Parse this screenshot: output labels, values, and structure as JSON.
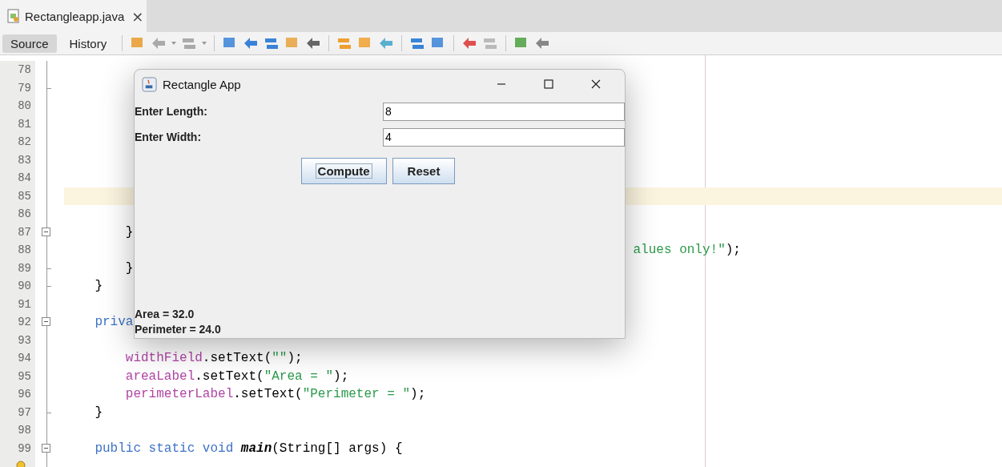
{
  "editor_tab": {
    "title": "Rectangleapp.java",
    "close": "×"
  },
  "view_tabs": [
    {
      "label": "Source",
      "selected": true
    },
    {
      "label": "History",
      "selected": false
    }
  ],
  "code": {
    "lines": [
      {
        "number": "78",
        "current": false,
        "hint": false
      },
      {
        "number": "79",
        "current": false,
        "hint": false,
        "fold": {
          "kind": "end"
        }
      },
      {
        "number": "80",
        "current": false,
        "hint": false
      },
      {
        "number": "81",
        "current": false,
        "hint": false
      },
      {
        "number": "82",
        "current": false,
        "hint": false
      },
      {
        "number": "83",
        "current": false,
        "hint": false
      },
      {
        "number": "84",
        "current": false,
        "hint": false
      },
      {
        "number": "85",
        "current": true,
        "hint": false
      },
      {
        "number": "86",
        "current": false,
        "hint": false
      },
      {
        "number": "87",
        "current": false,
        "hint": false,
        "fold": {
          "kind": "open"
        },
        "tokens": [
          {
            "text": "        }",
            "kind": "plain"
          }
        ]
      },
      {
        "number": "88",
        "current": false,
        "hint": false,
        "tokens": [
          {
            "text": "                                                                          alues only!\"",
            "kind": "string"
          },
          {
            "text": ");",
            "kind": "plain"
          }
        ]
      },
      {
        "number": "89",
        "current": false,
        "hint": false,
        "fold": {
          "kind": "end"
        },
        "tokens": [
          {
            "text": "        }",
            "kind": "plain"
          }
        ]
      },
      {
        "number": "90",
        "current": false,
        "hint": false,
        "fold": {
          "kind": "close"
        },
        "tokens": [
          {
            "text": "    }",
            "kind": "plain"
          }
        ]
      },
      {
        "number": "91",
        "current": false,
        "hint": false
      },
      {
        "number": "92",
        "current": false,
        "hint": false,
        "fold": {
          "kind": "open"
        },
        "tokens": [
          {
            "text": "    priva",
            "kind": "keyword"
          }
        ]
      },
      {
        "number": "93",
        "current": false,
        "hint": false
      },
      {
        "number": "94",
        "current": false,
        "hint": false,
        "tokens": [
          {
            "text": "        widthField",
            "kind": "field"
          },
          {
            "text": ".setText(",
            "kind": "plain"
          },
          {
            "text": "\"\"",
            "kind": "string"
          },
          {
            "text": ");",
            "kind": "plain"
          }
        ]
      },
      {
        "number": "95",
        "current": false,
        "hint": false,
        "tokens": [
          {
            "text": "        areaLabel",
            "kind": "field"
          },
          {
            "text": ".setText(",
            "kind": "plain"
          },
          {
            "text": "\"Area = \"",
            "kind": "string"
          },
          {
            "text": ");",
            "kind": "plain"
          }
        ]
      },
      {
        "number": "96",
        "current": false,
        "hint": false,
        "tokens": [
          {
            "text": "        perimeterLabel",
            "kind": "field"
          },
          {
            "text": ".setText(",
            "kind": "plain"
          },
          {
            "text": "\"Perimeter = \"",
            "kind": "string"
          },
          {
            "text": ");",
            "kind": "plain"
          }
        ]
      },
      {
        "number": "97",
        "current": false,
        "hint": false,
        "fold": {
          "kind": "close"
        },
        "tokens": [
          {
            "text": "    }",
            "kind": "plain"
          }
        ]
      },
      {
        "number": "98",
        "current": false,
        "hint": false
      },
      {
        "number": "99",
        "current": false,
        "hint": false,
        "fold": {
          "kind": "open"
        },
        "tokens": [
          {
            "text": "    public static void ",
            "kind": "keyword"
          },
          {
            "text": "main",
            "kind": "method"
          },
          {
            "text": "(String[] args) {",
            "kind": "plain"
          }
        ]
      },
      {
        "current": false,
        "hint": true
      }
    ]
  },
  "dialog": {
    "title": "Rectangle App",
    "fields": [
      {
        "label": "Enter Length:",
        "value": "8"
      },
      {
        "label": "Enter Width:",
        "value": "4"
      }
    ],
    "buttons": [
      {
        "label": "Compute",
        "focused": true
      },
      {
        "label": "Reset",
        "focused": false
      }
    ],
    "results": [
      "Area = 32.0",
      "Perimeter = 24.0"
    ]
  }
}
